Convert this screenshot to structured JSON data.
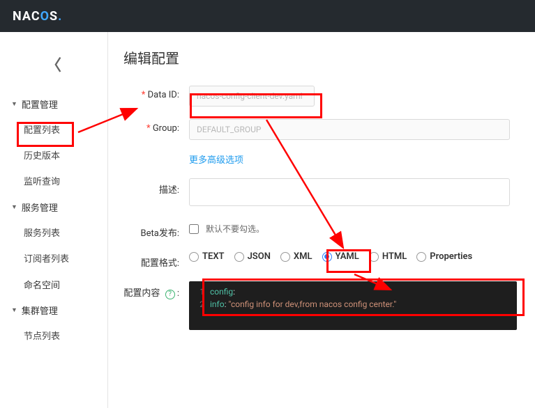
{
  "brand": "NACOS.",
  "page_title": "编辑配置",
  "sidebar": {
    "groups": [
      {
        "label": "配置管理",
        "items": [
          {
            "label": "配置列表",
            "active": true
          },
          {
            "label": "历史版本"
          },
          {
            "label": "监听查询"
          }
        ]
      },
      {
        "label": "服务管理",
        "items": [
          {
            "label": "服务列表"
          },
          {
            "label": "订阅者列表"
          }
        ]
      },
      {
        "label": "命名空间",
        "items": []
      },
      {
        "label": "集群管理",
        "items": [
          {
            "label": "节点列表"
          }
        ]
      }
    ]
  },
  "form": {
    "data_id_label": "Data ID:",
    "data_id_value": "nacos-config-client-dev.yaml",
    "group_label": "Group:",
    "group_value": "DEFAULT_GROUP",
    "adv_link": "更多高级选项",
    "desc_label": "描述:",
    "beta_label": "Beta发布:",
    "beta_hint": "默认不要勾选。",
    "fmt_label": "配置格式:",
    "fmt_options": [
      "TEXT",
      "JSON",
      "XML",
      "YAML",
      "HTML",
      "Properties"
    ],
    "fmt_selected": "YAML",
    "content_label": "配置内容",
    "help_icon": "?"
  },
  "editor": {
    "line1_key": "config",
    "line2_key": "info",
    "line2_val": "\"config info for dev,from nacos config center.\"",
    "indent": "    "
  }
}
